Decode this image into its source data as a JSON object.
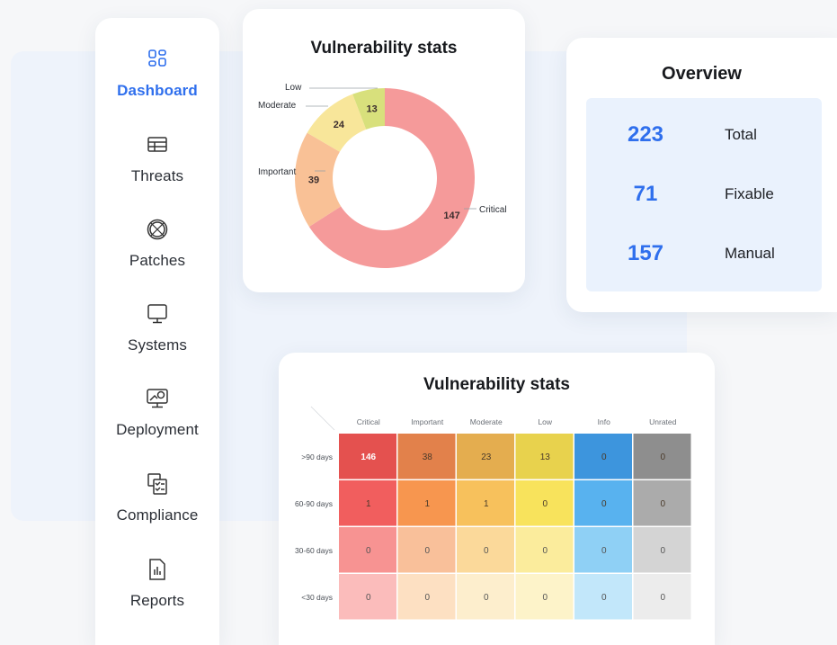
{
  "sidebar": {
    "items": [
      {
        "label": "Dashboard",
        "icon": "dashboard-icon",
        "active": true
      },
      {
        "label": "Threats",
        "icon": "threats-icon",
        "active": false
      },
      {
        "label": "Patches",
        "icon": "patches-icon",
        "active": false
      },
      {
        "label": "Systems",
        "icon": "monitor-icon",
        "active": false
      },
      {
        "label": "Deployment",
        "icon": "deployment-icon",
        "active": false
      },
      {
        "label": "Compliance",
        "icon": "compliance-icon",
        "active": false
      },
      {
        "label": "Reports",
        "icon": "reports-icon",
        "active": false
      }
    ],
    "accent_color": "#2f6fed"
  },
  "donut": {
    "title": "Vulnerability stats"
  },
  "overview": {
    "title": "Overview",
    "rows": [
      {
        "value": "223",
        "label": "Total"
      },
      {
        "value": "71",
        "label": "Fixable"
      },
      {
        "value": "157",
        "label": "Manual"
      }
    ]
  },
  "heatmap": {
    "title": "Vulnerability stats"
  },
  "chart_data": [
    {
      "type": "pie",
      "title": "Vulnerability stats",
      "categories": [
        "Critical",
        "Important",
        "Moderate",
        "Low"
      ],
      "values": [
        147,
        39,
        24,
        13
      ],
      "colors": [
        "#f59a9a",
        "#f9c196",
        "#f8e69a",
        "#d8e07c"
      ]
    },
    {
      "type": "heatmap",
      "title": "Vulnerability stats",
      "columns": [
        "Critical",
        "Important",
        "Moderate",
        "Low",
        "Info",
        "Unrated"
      ],
      "rows": [
        ">90 days",
        "60-90 days",
        "30-60 days",
        "<30 days"
      ],
      "values": [
        [
          146,
          38,
          23,
          13,
          0,
          0
        ],
        [
          1,
          1,
          1,
          0,
          0,
          0
        ],
        [
          0,
          0,
          0,
          0,
          0,
          0
        ],
        [
          0,
          0,
          0,
          0,
          0,
          0
        ]
      ],
      "colors": [
        [
          "#e4514f",
          "#e2814b",
          "#e4ad4f",
          "#e8d24d",
          "#3d95dd",
          "#8e8e8e"
        ],
        [
          "#f15e5e",
          "#f7964f",
          "#f7c15c",
          "#f8e35c",
          "#58b2ef",
          "#ababab"
        ],
        [
          "#f79392",
          "#f9c09a",
          "#fbd99a",
          "#fbec9c",
          "#8fd0f5",
          "#d4d4d4"
        ],
        [
          "#fbbcbb",
          "#fde0c2",
          "#fdeecd",
          "#fdf3c9",
          "#c2e7fa",
          "#ececec"
        ]
      ]
    }
  ]
}
